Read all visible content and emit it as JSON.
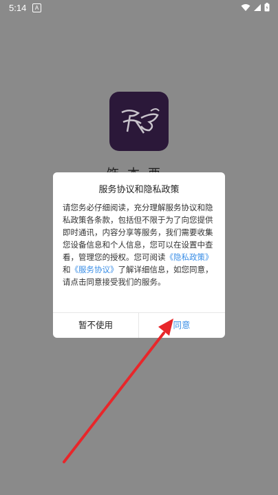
{
  "status_bar": {
    "time": "5:14",
    "notif_letter": "A"
  },
  "app": {
    "name_peek": "饰本西"
  },
  "dialog": {
    "title": "服务协议和隐私政策",
    "body_before": "请您务必仔细阅读，充分理解服务协议和隐私政策各条款，包括但不限于为了向您提供即时通讯，内容分享等服务，我们需要收集您设备信息和个人信息，您可以在设置中查看，管理您的授权。您可阅读",
    "privacy_link": "《隐私政策》",
    "and_text": "和",
    "service_link": "《服务协议》",
    "body_after": "了解详细信息，如您同意，请点击同意接受我们的服务。",
    "decline_label": "暂不使用",
    "agree_label": "同意"
  },
  "colors": {
    "link": "#3a8ee6",
    "arrow": "#e8262a",
    "logo_bg": "#2b1839"
  }
}
